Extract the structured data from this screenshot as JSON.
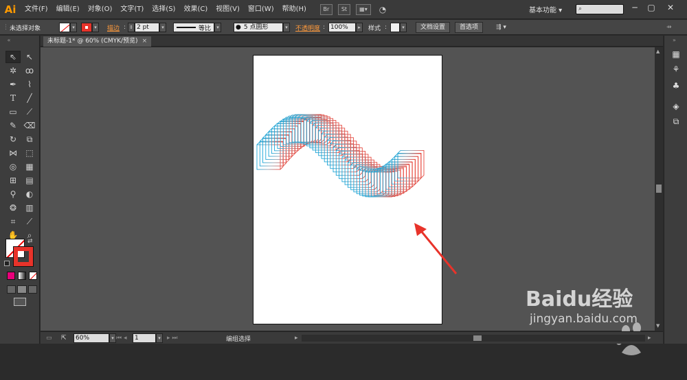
{
  "app": {
    "logo": "Ai"
  },
  "menu": [
    "文件(F)",
    "编辑(E)",
    "对象(O)",
    "文字(T)",
    "选择(S)",
    "效果(C)",
    "视图(V)",
    "窗口(W)",
    "帮助(H)"
  ],
  "menu_icons": [
    "Br",
    "St"
  ],
  "workspace": "基本功能",
  "control": {
    "selection": "未选择对象",
    "stroke_label": "描边",
    "stroke_value": "2 pt",
    "profile": "等比",
    "brush": "5 点圆形",
    "opacity_label": "不透明度",
    "opacity_value": "100%",
    "style_label": "样式",
    "doc_setup": "文档设置",
    "prefs": "首选项"
  },
  "document": {
    "tab": "未标题-1* @ 60% (CMYK/预览)",
    "close": "×"
  },
  "status": {
    "zoom": "60%",
    "page": "1",
    "info": "编组选择"
  },
  "watermark": {
    "brand": "Baidu经验",
    "url": "jingyan.baidu.com"
  },
  "colors": {
    "fill": "#ffffff",
    "stroke": "#e8332a",
    "blend_start": "#1aa6d8",
    "blend_end": "#e8453a",
    "arrow": "#e8332a"
  }
}
